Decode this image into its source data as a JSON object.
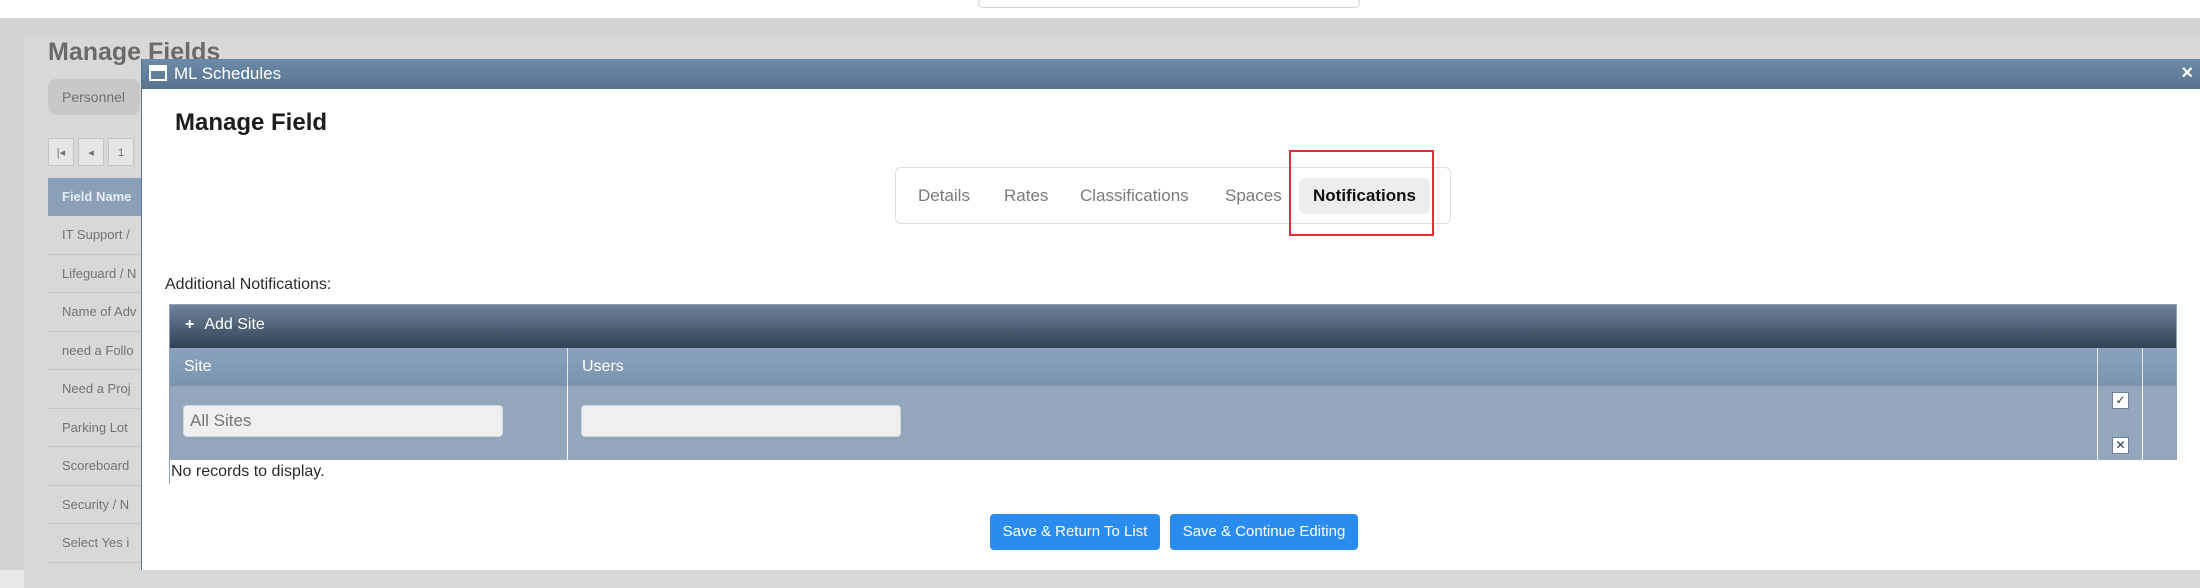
{
  "background": {
    "page_title": "Manage Fields",
    "filter_tab": "Personnel",
    "pager": [
      "|◂",
      "◂",
      "1"
    ],
    "column_header": "Field Name",
    "rows": [
      "IT Support /",
      "Lifeguard / N",
      "Name of Adv",
      "need a Follo",
      "Need a Proj",
      "Parking Lot",
      "Scoreboard",
      "Security / N",
      "Select Yes i"
    ]
  },
  "modal": {
    "window_title": "ML Schedules",
    "close_glyph": "×",
    "heading": "Manage Field",
    "tabs": [
      {
        "label": "Details"
      },
      {
        "label": "Rates"
      },
      {
        "label": "Classifications"
      },
      {
        "label": "Spaces"
      },
      {
        "label": "Notifications",
        "active": true
      }
    ],
    "section_label": "Additional Notifications:",
    "grid": {
      "toolbar": {
        "add_icon": "+",
        "add_label": "Add Site"
      },
      "columns": [
        "Site",
        "Users"
      ],
      "filters": {
        "site_placeholder": "All Sites",
        "users_value": ""
      },
      "check_glyph": "✓",
      "clear_glyph": "✕",
      "empty_message": "No records to display."
    },
    "buttons": {
      "save_return": "Save & Return To List",
      "save_continue": "Save & Continue Editing"
    }
  },
  "colors": {
    "accent": "#2a8cee",
    "titlebar": "#56738f",
    "highlight": "#e0313a"
  }
}
